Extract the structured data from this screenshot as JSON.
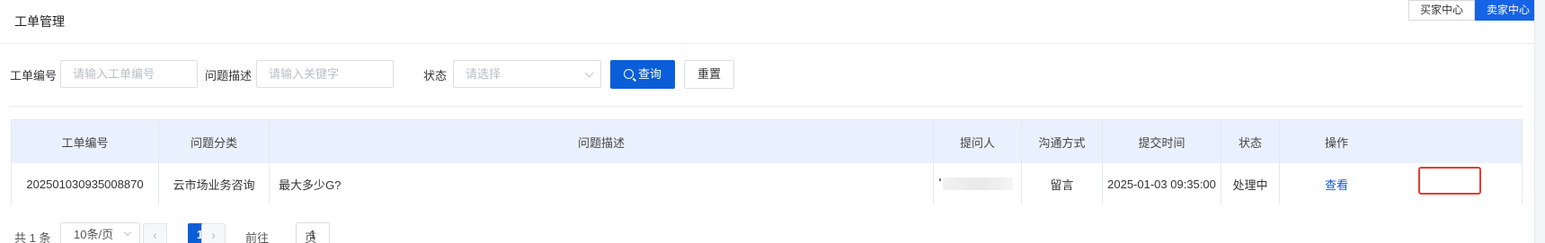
{
  "header": {
    "title": "工单管理",
    "buyer_center": "买家中心",
    "seller_center": "卖家中心"
  },
  "filters": {
    "ticket_no_label": "工单编号",
    "ticket_no_placeholder": "请输入工单编号",
    "desc_label": "问题描述",
    "desc_placeholder": "请输入关键字",
    "status_label": "状态",
    "status_placeholder": "请选择",
    "search_label": "查询",
    "reset_label": "重置"
  },
  "table": {
    "columns": [
      "工单编号",
      "问题分类",
      "问题描述",
      "提问人",
      "沟通方式",
      "提交时间",
      "状态",
      "操作"
    ],
    "rows": [
      {
        "ticket_no": "202501030935008870",
        "category": "云市场业务咨询",
        "description": "最大多少G?",
        "contact_method": "留言",
        "submit_time": "2025-01-03 09:35:00",
        "status": "处理中",
        "action": "查看"
      }
    ]
  },
  "pagination": {
    "total": "共 1 条",
    "page_size": "10条/页",
    "prev": "‹",
    "current_page": "1",
    "next": "›",
    "goto_prefix": "前往",
    "goto_value": "1",
    "goto_suffix": "页"
  },
  "colors": {
    "primary": "#0a5ed7",
    "header_bg": "#eaf1fe",
    "highlight": "#e53b2f"
  }
}
